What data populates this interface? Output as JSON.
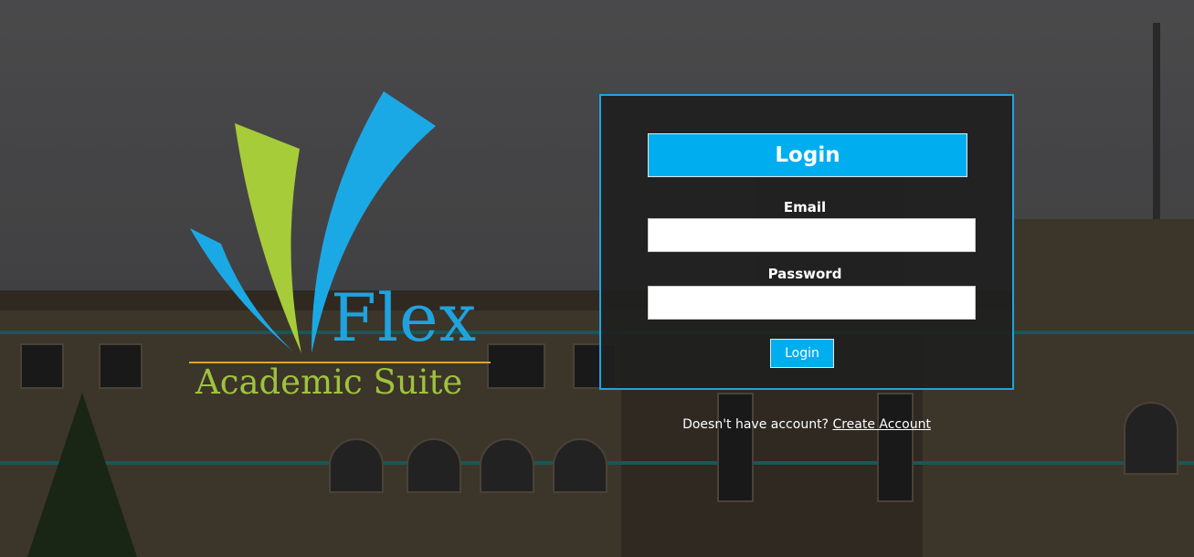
{
  "brand": {
    "name": "Flex",
    "tagline": "Academic Suite"
  },
  "login": {
    "title": "Login",
    "email_label": "Email",
    "email_value": "",
    "password_label": "Password",
    "password_value": "",
    "submit_label": "Login"
  },
  "signup": {
    "prompt": "Doesn't have account?",
    "link_label": "Create Account"
  },
  "colors": {
    "accent": "#00aeef",
    "logo_blue": "#1fa3df",
    "logo_green": "#9ec33d",
    "logo_gold": "#e0a42a"
  }
}
